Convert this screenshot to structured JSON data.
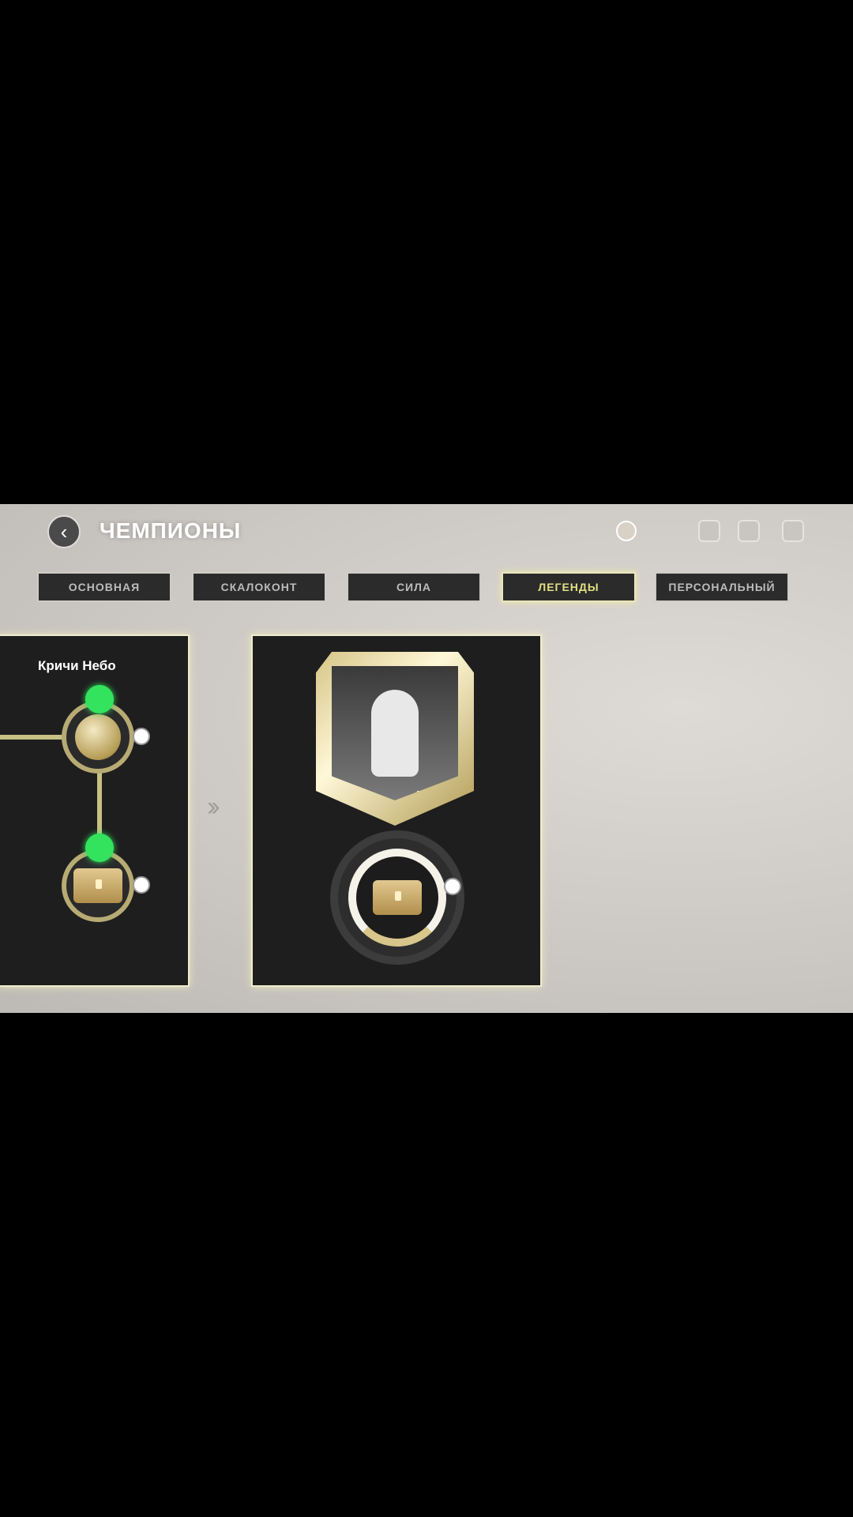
{
  "header": {
    "back_icon": "chevron-left-icon",
    "title": "ЧЕМПИОНЫ"
  },
  "tabs": [
    {
      "label": "ОСНОВНАЯ",
      "active": false
    },
    {
      "label": "СКАЛОКОНТ",
      "active": false
    },
    {
      "label": "СИЛА",
      "active": false
    },
    {
      "label": "ЛЕГЕНДЫ",
      "active": true
    },
    {
      "label": "ПЕРСОНАЛЬНЫЙ",
      "active": false
    }
  ],
  "left_panel": {
    "label": "Кричи Небо"
  },
  "colors": {
    "active_tab_text": "#e3df84",
    "progress_green": "#33e35e",
    "track_gold": "#c8c084",
    "panel_bg": "#1e1e1e"
  }
}
